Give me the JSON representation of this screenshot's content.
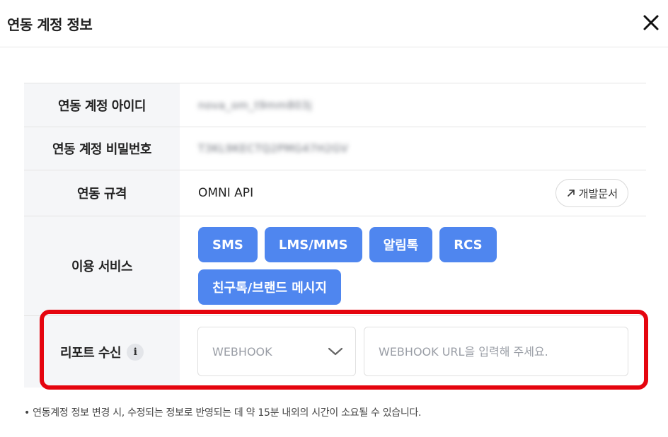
{
  "dialog": {
    "title": "연동 계정 정보"
  },
  "rows": {
    "account_id": {
      "label": "연동 계정 아이디",
      "value": "nova_om_t9mm803j"
    },
    "account_password": {
      "label": "연동 계정 비밀번호",
      "value": "T3KL9KECTQ2PMG47H2GV"
    },
    "spec": {
      "label": "연동 규격",
      "value": "OMNI API",
      "doc_button": "개발문서"
    },
    "services": {
      "label": "이용 서비스",
      "items": [
        "SMS",
        "LMS/MMS",
        "알림톡",
        "RCS",
        "친구톡/브랜드 메시지"
      ]
    },
    "report": {
      "label": "리포트 수신",
      "info_icon": "i",
      "select_value": "WEBHOOK",
      "url_placeholder": "WEBHOOK URL을 입력해 주세요."
    }
  },
  "note": "• 연동계정 정보 변경 시, 수정되는 정보로 반영되는 데 약 15분 내외의 시간이 소요될 수 있습니다.",
  "colors": {
    "service_button": "#4f86ef",
    "highlight": "#e5050f",
    "header_cell": "#f5f6f8"
  },
  "icons": [
    "close-icon",
    "external-link-icon",
    "info-icon",
    "chevron-down-icon"
  ]
}
